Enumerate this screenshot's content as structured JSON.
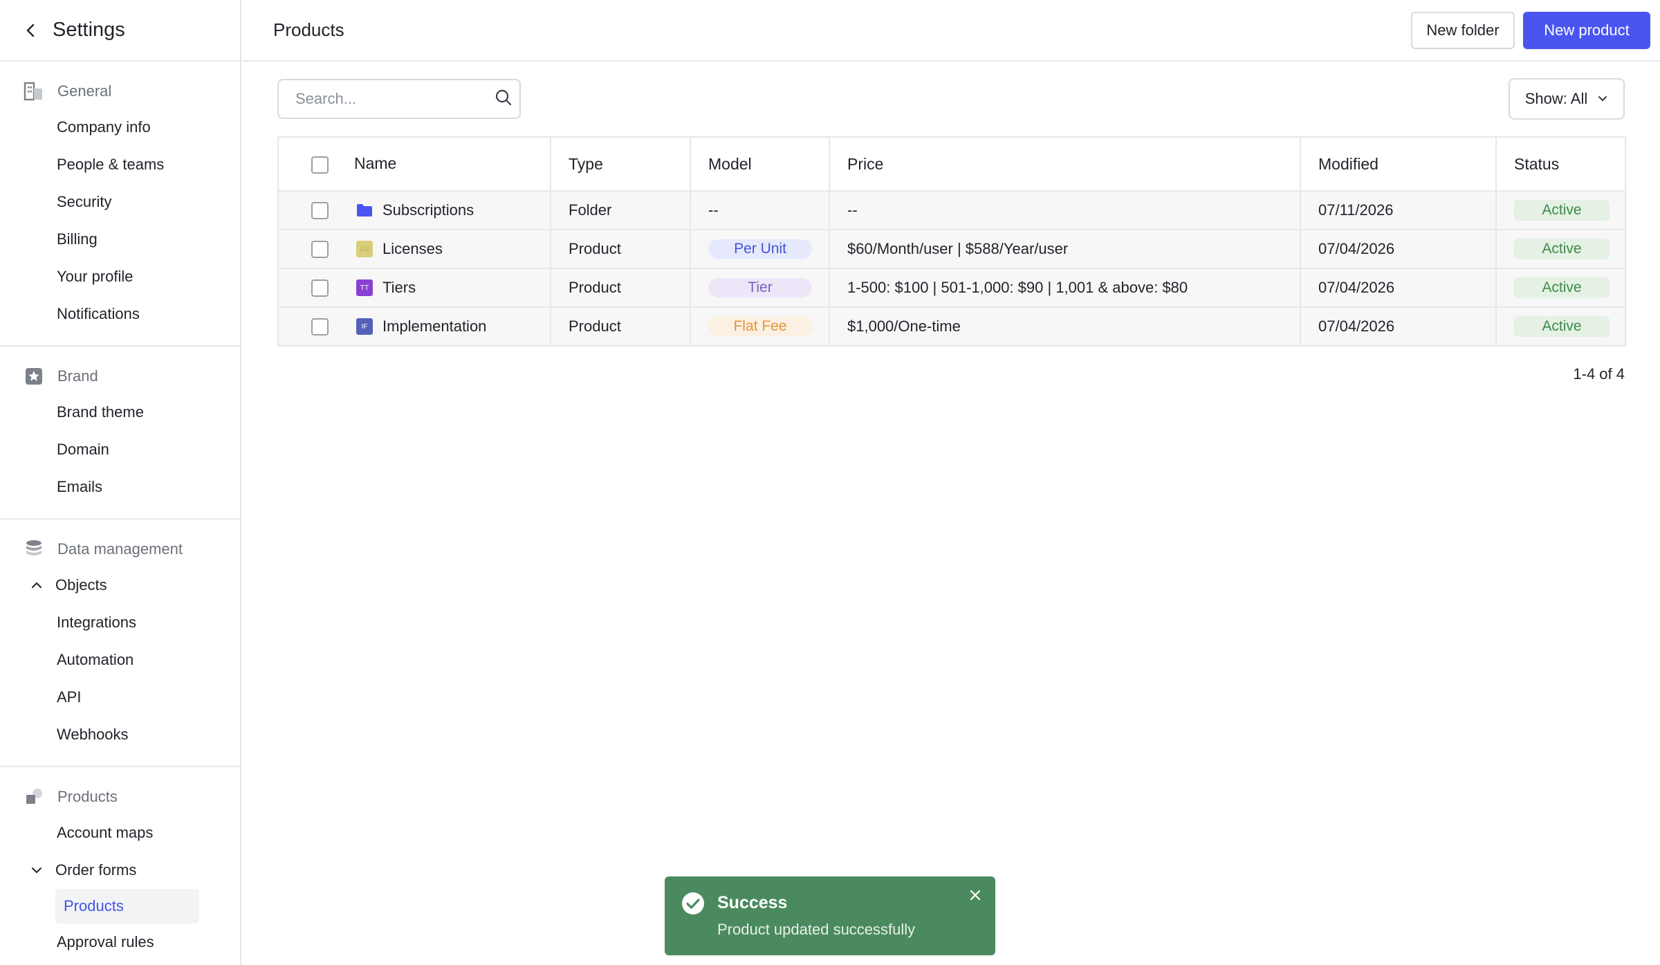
{
  "sidebar": {
    "title": "Settings",
    "groups": [
      {
        "label": "General",
        "icon": "building-icon",
        "items": [
          "Company info",
          "People & teams",
          "Security",
          "Billing",
          "Your profile",
          "Notifications"
        ]
      },
      {
        "label": "Brand",
        "icon": "star-icon",
        "items": [
          "Brand theme",
          "Domain",
          "Emails"
        ]
      },
      {
        "label": "Data management",
        "icon": "database-icon",
        "sub": "Objects",
        "items": [
          "Integrations",
          "Automation",
          "API",
          "Webhooks"
        ]
      },
      {
        "label": "Products",
        "icon": "products-icon",
        "items": [
          "Account maps"
        ],
        "sub": "Order forms",
        "sub_items": [
          "Products",
          "Approval rules"
        ]
      }
    ]
  },
  "header": {
    "title": "Products",
    "new_folder": "New folder",
    "new_product": "New product"
  },
  "toolbar": {
    "search_placeholder": "Search...",
    "show_label": "Show: All"
  },
  "table": {
    "columns": [
      "Name",
      "Type",
      "Model",
      "Price",
      "Modified",
      "Status"
    ],
    "rows": [
      {
        "name": "Subscriptions",
        "icon": "folder-icon",
        "icon_text": "",
        "type": "Folder",
        "model": "--",
        "price": "--",
        "modified": "07/11/2026",
        "status": "Active"
      },
      {
        "name": "Licenses",
        "icon": "licenses-icon",
        "icon_text": "LU",
        "type": "Product",
        "model": "Per Unit",
        "price": "$60/Month/user | $588/Year/user",
        "modified": "07/04/2026",
        "status": "Active"
      },
      {
        "name": "Tiers",
        "icon": "tiers-icon",
        "icon_text": "TT",
        "type": "Product",
        "model": "Tier",
        "price": "1-500: $100 | 501-1,000: $90 | 1,001 & above: $80",
        "modified": "07/04/2026",
        "status": "Active"
      },
      {
        "name": "Implementation",
        "icon": "implementation-icon",
        "icon_text": "IF",
        "type": "Product",
        "model": "Flat Fee",
        "price": "$1,000/One-time",
        "modified": "07/04/2026",
        "status": "Active"
      }
    ],
    "pagination": "1-4 of 4"
  },
  "toast": {
    "title": "Success",
    "message": "Product updated successfully"
  },
  "colors": {
    "primary": "#4a55f0",
    "active_link": "#4353e8",
    "toast_bg": "#4a8a5e",
    "status_active_bg": "#e4f1e4",
    "status_active_text": "#3d8a49",
    "per_unit_bg": "#e5e9fb",
    "per_unit_text": "#4455d8",
    "tier_bg": "#ece6f8",
    "tier_text": "#7a5cc4",
    "flat_fee_bg": "#fbf0e2",
    "flat_fee_text": "#e3953b"
  }
}
